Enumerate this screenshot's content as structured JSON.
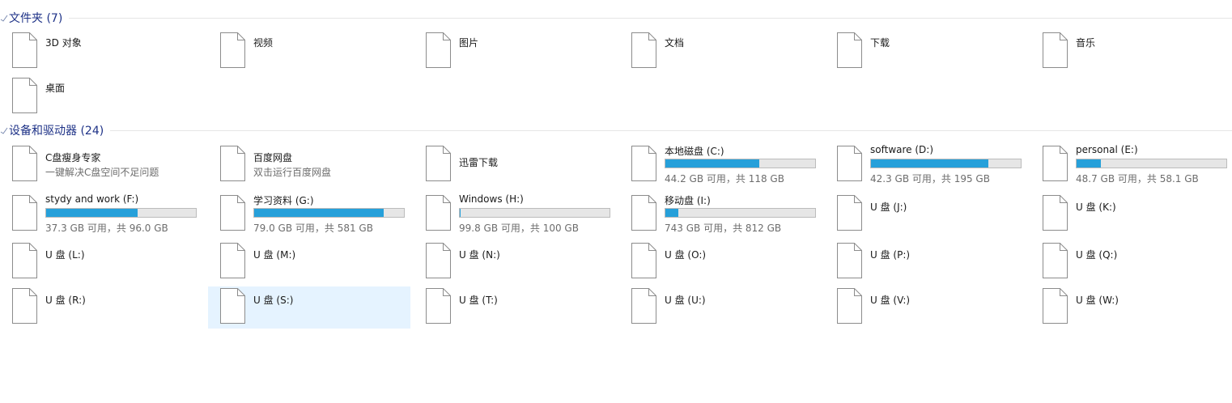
{
  "groups": [
    {
      "title": "文件夹 (7)",
      "items": [
        {
          "name": "3D 对象"
        },
        {
          "name": "视频"
        },
        {
          "name": "图片"
        },
        {
          "name": "文档"
        },
        {
          "name": "下载"
        },
        {
          "name": "音乐"
        },
        {
          "name": "桌面"
        }
      ]
    },
    {
      "title": "设备和驱动器 (24)",
      "items": [
        {
          "name": "C盘瘦身专家",
          "sub": "一键解决C盘空间不足问题"
        },
        {
          "name": "百度网盘",
          "sub": "双击运行百度网盘"
        },
        {
          "name": "迅雷下载"
        },
        {
          "name": "本地磁盘 (C:)",
          "usage": "44.2 GB 可用，共 118 GB",
          "used_fraction": 0.625
        },
        {
          "name": "software (D:)",
          "usage": "42.3 GB 可用，共 195 GB",
          "used_fraction": 0.783
        },
        {
          "name": "personal (E:)",
          "usage": "48.7 GB 可用，共 58.1 GB",
          "used_fraction": 0.162
        },
        {
          "name": "stydy and work (F:)",
          "usage": "37.3 GB 可用，共 96.0 GB",
          "used_fraction": 0.611
        },
        {
          "name": "学习资料 (G:)",
          "usage": "79.0 GB 可用，共 581 GB",
          "used_fraction": 0.864
        },
        {
          "name": "Windows (H:)",
          "usage": "99.8 GB 可用，共 100 GB",
          "used_fraction": 0.002
        },
        {
          "name": "移动盘 (I:)",
          "usage": "743 GB 可用，共 812 GB",
          "used_fraction": 0.085
        },
        {
          "name": "U 盘 (J:)"
        },
        {
          "name": "U 盘 (K:)"
        },
        {
          "name": "U 盘 (L:)"
        },
        {
          "name": "U 盘 (M:)"
        },
        {
          "name": "U 盘 (N:)"
        },
        {
          "name": "U 盘 (O:)"
        },
        {
          "name": "U 盘 (P:)"
        },
        {
          "name": "U 盘 (Q:)"
        },
        {
          "name": "U 盘 (R:)"
        },
        {
          "name": "U 盘 (S:)",
          "selected": true
        },
        {
          "name": "U 盘 (T:)"
        },
        {
          "name": "U 盘 (U:)"
        },
        {
          "name": "U 盘 (V:)"
        },
        {
          "name": "U 盘 (W:)"
        }
      ]
    }
  ],
  "icons": {
    "folder_item": "file-icon",
    "drive_item": "file-icon",
    "group_toggle": "chevron-down-icon"
  },
  "colors": {
    "group_title": "#1e3287",
    "usage_bar_fill": "#26a0da",
    "usage_bar_track": "#e6e6e6",
    "selection": "#e5f3ff"
  }
}
